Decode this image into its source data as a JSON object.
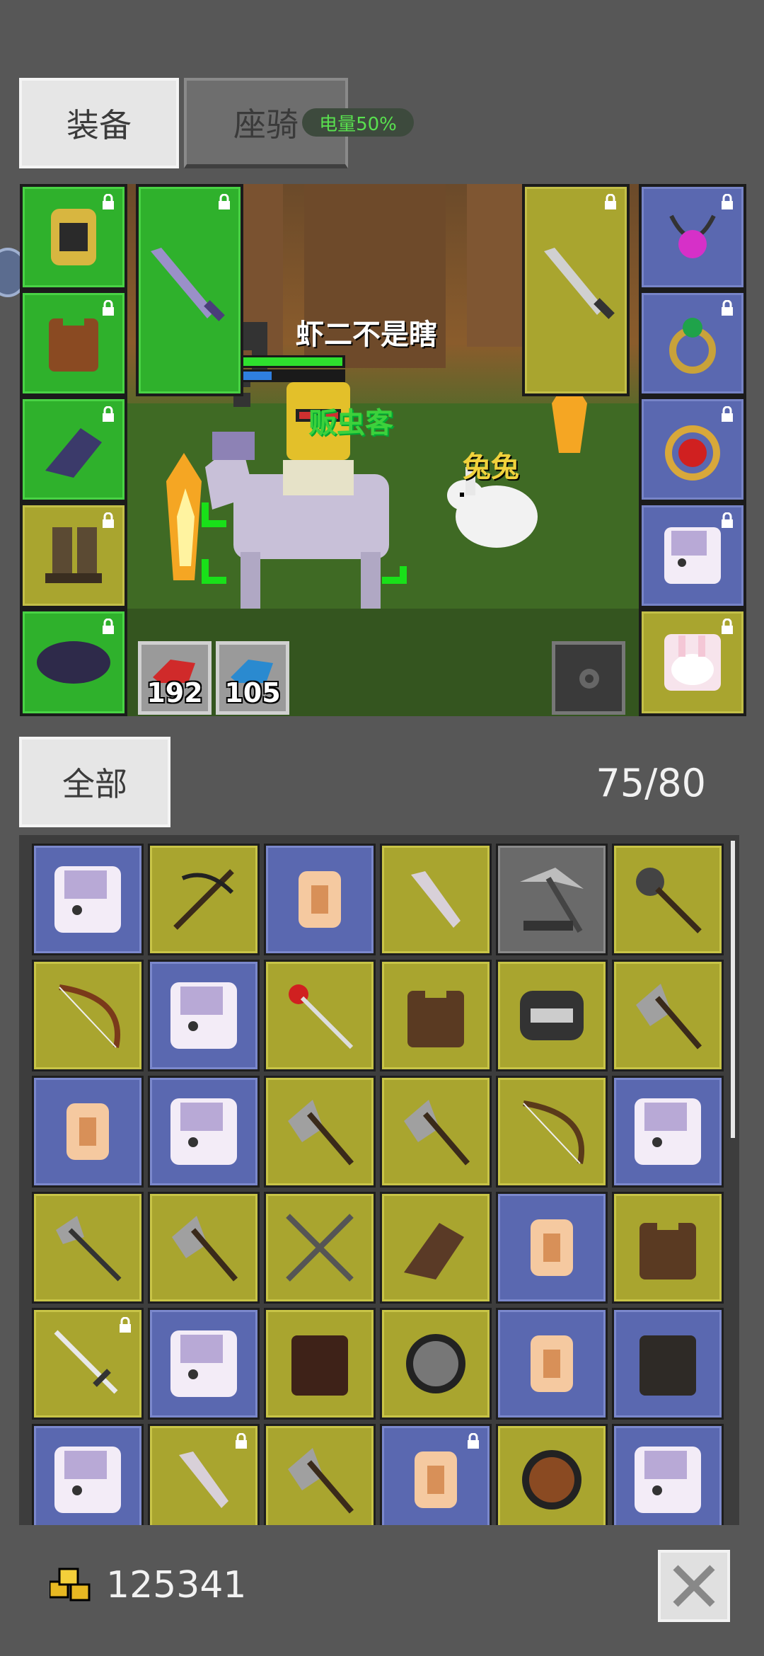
{
  "tabs": {
    "equipment": "装备",
    "mount": "座骑"
  },
  "battery": "电量50%",
  "scene": {
    "player_name": "虾二不是瞎",
    "guild_title": "贩虫客",
    "pet_name": "兔兔",
    "hp_potion_count": "192",
    "mp_potion_count": "105"
  },
  "inventory": {
    "filter_label": "全部",
    "capacity": "75/80"
  },
  "footer": {
    "gold": "125341"
  },
  "colors": {
    "green_slot": "#2fb12c",
    "olive_slot": "#a9a52f",
    "blue_slot": "#5a68b0",
    "background": "#575757"
  }
}
